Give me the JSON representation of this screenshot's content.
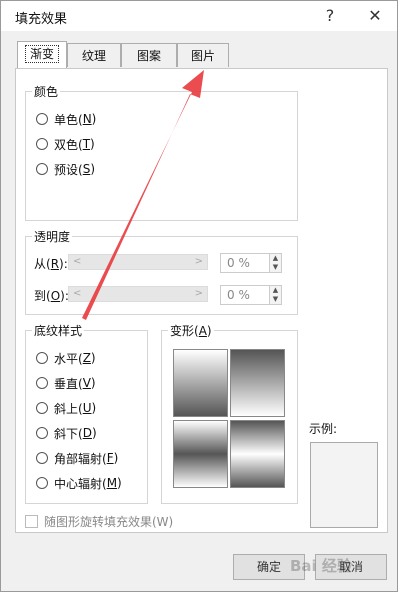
{
  "dialog": {
    "title": "填充效果",
    "help": "?",
    "close": "✕"
  },
  "tabs": [
    {
      "label": "渐变",
      "active": true
    },
    {
      "label": "纹理",
      "active": false
    },
    {
      "label": "图案",
      "active": false
    },
    {
      "label": "图片",
      "active": false
    }
  ],
  "colors": {
    "label": "颜色",
    "options": [
      {
        "text": "单色(",
        "key": "N",
        "close": ")"
      },
      {
        "text": "双色(",
        "key": "T",
        "close": ")"
      },
      {
        "text": "预设(",
        "key": "S",
        "close": ")"
      }
    ]
  },
  "transparency": {
    "label": "透明度",
    "from_label": "从(",
    "from_key": "R",
    "from_close": "):",
    "to_label": "到(",
    "to_key": "O",
    "to_close": "):",
    "from_value": "0 %",
    "to_value": "0 %"
  },
  "shading": {
    "label": "底纹样式",
    "options": [
      {
        "text": "水平(",
        "key": "Z",
        "close": ")"
      },
      {
        "text": "垂直(",
        "key": "V",
        "close": ")"
      },
      {
        "text": "斜上(",
        "key": "U",
        "close": ")"
      },
      {
        "text": "斜下(",
        "key": "D",
        "close": ")"
      },
      {
        "text": "角部辐射(",
        "key": "F",
        "close": ")"
      },
      {
        "text": "中心辐射(",
        "key": "M",
        "close": ")"
      }
    ]
  },
  "variants": {
    "label": "变形(",
    "key": "A",
    "close": ")"
  },
  "sample": {
    "label": "示例:"
  },
  "rotate_checkbox": {
    "label": "随图形旋转填充效果(W)"
  },
  "buttons": {
    "ok": "确定",
    "cancel": "取消"
  },
  "watermark": "Bai 经验",
  "accent_color": "#e8383d"
}
